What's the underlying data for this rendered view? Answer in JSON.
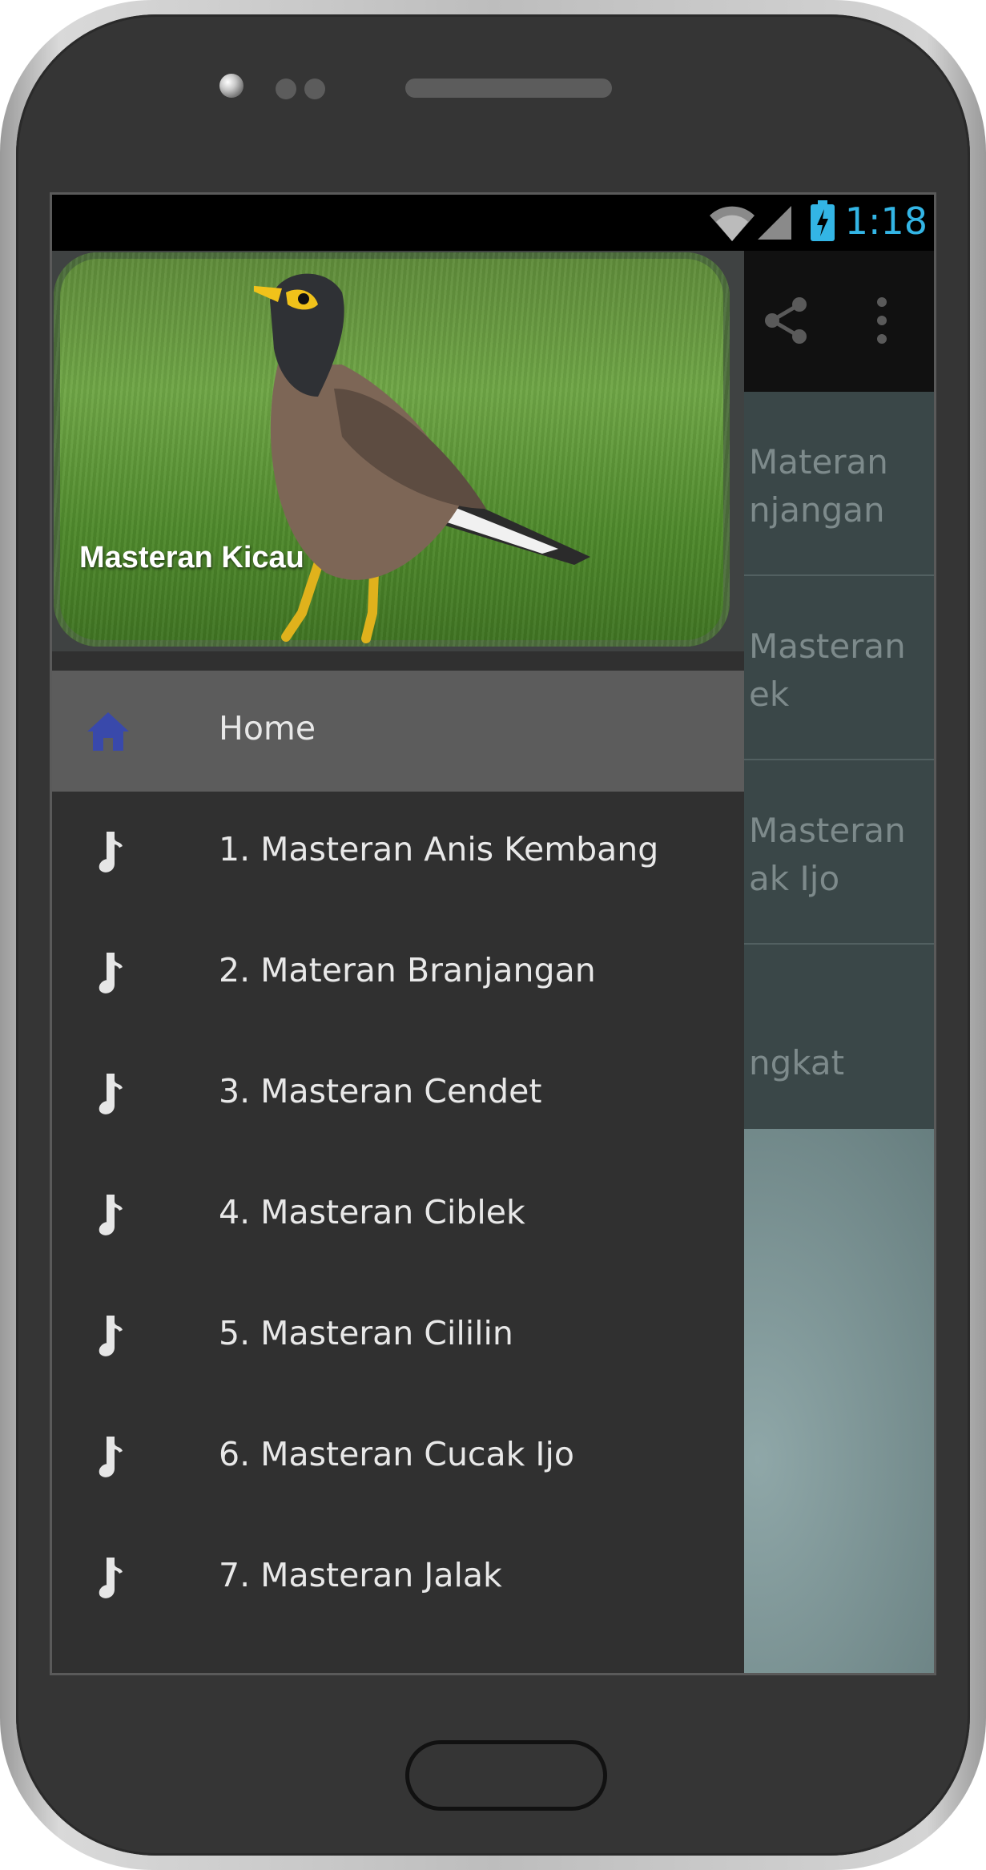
{
  "status_bar": {
    "time": "1:18"
  },
  "drawer": {
    "header_title": "Masteran Kicau",
    "items": [
      {
        "label": "Home",
        "icon": "home-icon",
        "active": true
      },
      {
        "label": "1. Masteran Anis Kembang",
        "icon": "music-note-icon"
      },
      {
        "label": "2. Materan Branjangan",
        "icon": "music-note-icon"
      },
      {
        "label": "3. Masteran Cendet",
        "icon": "music-note-icon"
      },
      {
        "label": "4. Masteran Ciblek",
        "icon": "music-note-icon"
      },
      {
        "label": "5. Masteran Cililin",
        "icon": "music-note-icon"
      },
      {
        "label": "6. Masteran Cucak Ijo",
        "icon": "music-note-icon"
      },
      {
        "label": "7. Masteran Jalak",
        "icon": "music-note-icon"
      }
    ]
  },
  "background_list": {
    "rows": [
      {
        "text": "Materan\nnjangan"
      },
      {
        "text": "Masteran\nek"
      },
      {
        "text": "Masteran\nak Ijo"
      },
      {
        "text": "ngkat"
      }
    ]
  },
  "colors": {
    "status_accent": "#33b5e5",
    "home_icon": "#3949ab",
    "drawer_bg": "#303030",
    "active_item_bg": "#5c5c5c"
  }
}
